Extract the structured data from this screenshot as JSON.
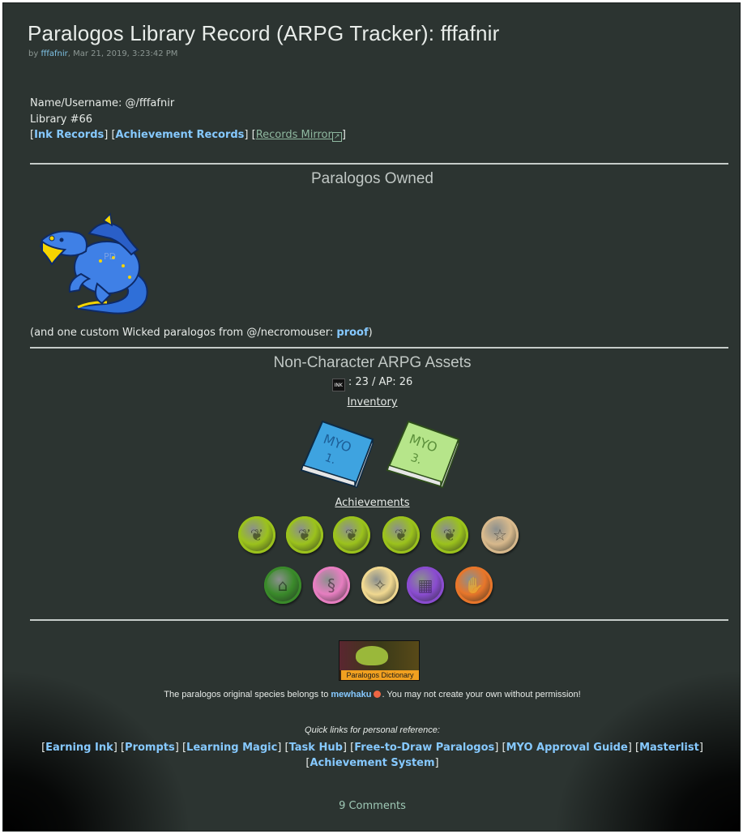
{
  "post": {
    "title": "Paralogos Library Record (ARPG Tracker): fffafnir",
    "by_prefix": "by",
    "author": "fffafnir",
    "date": ", Mar 21, 2019, 3:23:42 PM"
  },
  "info": {
    "name_line": "Name/Username: @/fffafnir",
    "library_line": "Library #66",
    "links": {
      "ink_records": "Ink Records",
      "achievement_records": "Achievement Records",
      "records_mirror": "Records Mirror"
    }
  },
  "owned": {
    "heading": "Paralogos Owned",
    "custom_prefix": "(and one custom Wicked paralogos from @/necromouser: ",
    "proof": "proof",
    "custom_suffix": ")"
  },
  "assets": {
    "heading": "Non-Character ARPG Assets",
    "ink_icon_label": "INK",
    "currency_line": ": 23 / AP: 26",
    "inventory_label": "Inventory",
    "inventory_items": [
      {
        "title": "MYO",
        "sub": "1."
      },
      {
        "title": "MYO",
        "sub": "3."
      }
    ],
    "achievements_label": "Achievements",
    "colors": {
      "green": "#9bc21c",
      "tan": "#d8b98c",
      "dark_green": "#3a8a2a",
      "pink": "#e67ec0",
      "cream": "#f0d890",
      "purple": "#8a4cd0",
      "orange": "#e8762a"
    },
    "badges_row1": [
      "sprout-badge",
      "sprout-badge",
      "sprout-badge",
      "sprout-badge",
      "sprout-badge",
      "star-badge"
    ],
    "badges_row2": [
      "house-badge",
      "dragon-badge",
      "rune-badge",
      "calendar-badge",
      "handshake-badge"
    ]
  },
  "footer": {
    "banner_text": "Paralogos Dictionary",
    "species_prefix": "The paralogos original species belongs to ",
    "species_owner": "mewhaku",
    "species_suffix": ". You may not create your own without permission!",
    "quick_links_label": "Quick links for personal reference:",
    "quick_links": [
      "Earning Ink",
      "Prompts",
      "Learning Magic",
      "Task Hub",
      "Free-to-Draw Paralogos",
      "MYO Approval Guide",
      "Masterlist",
      "Achievement System"
    ]
  },
  "comments": "9 Comments"
}
